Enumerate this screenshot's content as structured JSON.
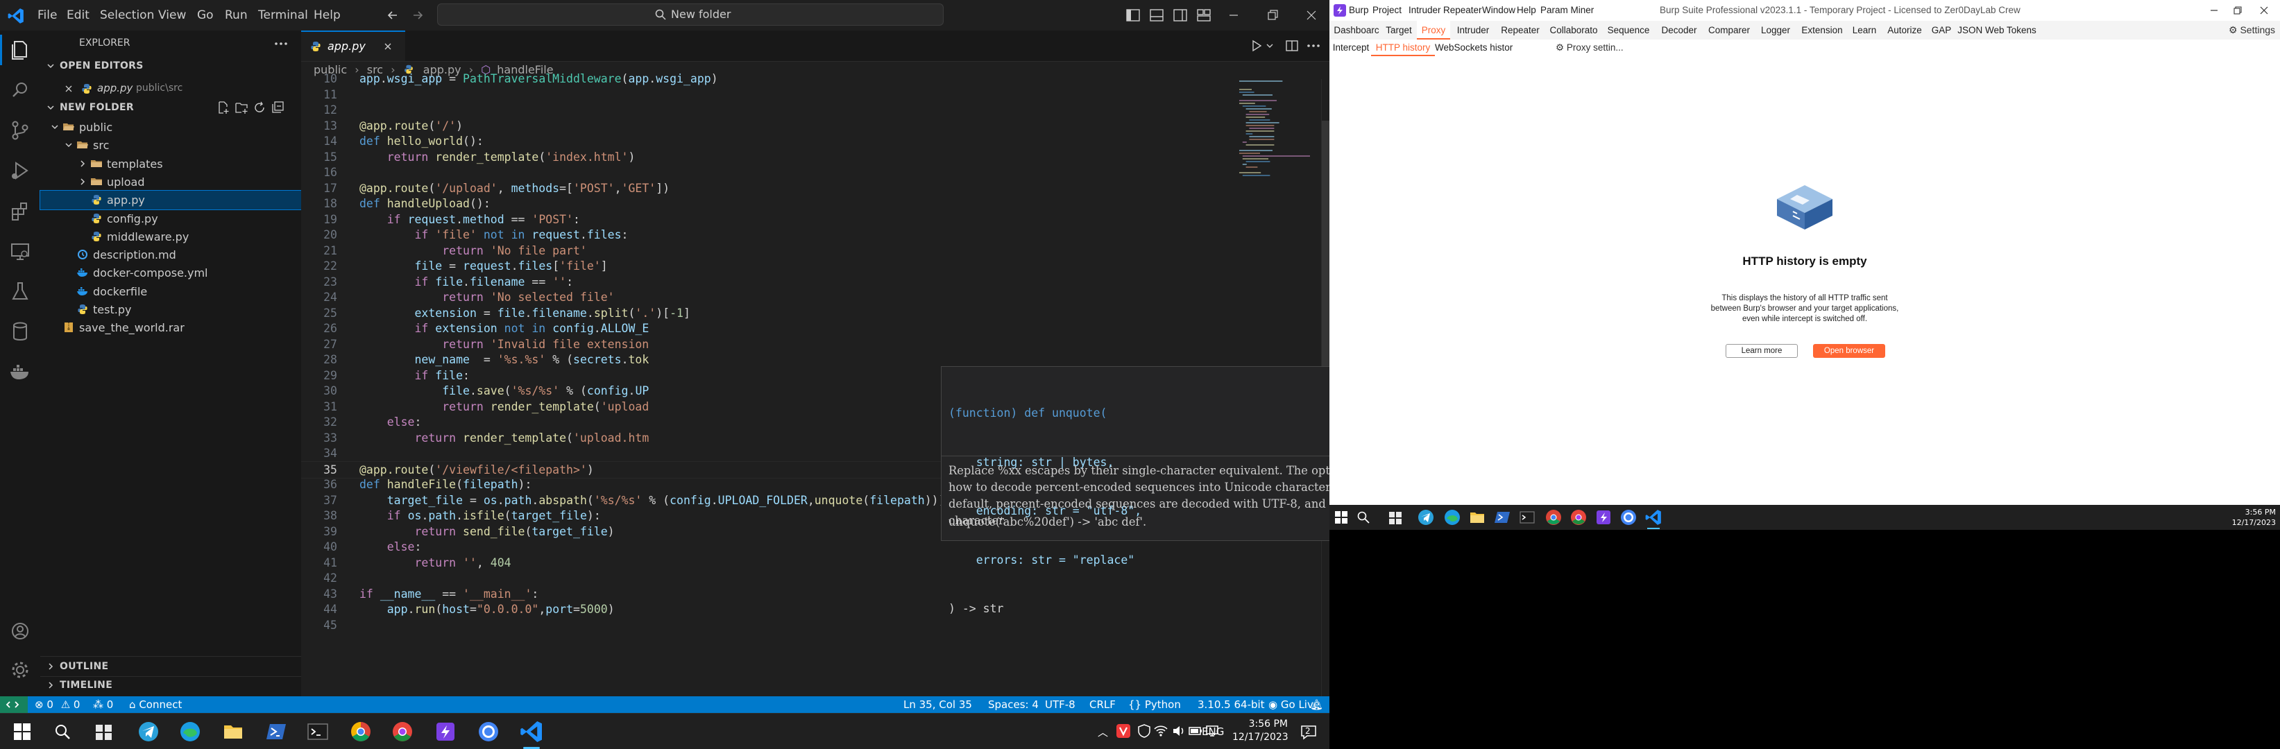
{
  "vscode": {
    "menu": [
      "File",
      "Edit",
      "Selection",
      "View",
      "Go",
      "Run",
      "Terminal",
      "Help"
    ],
    "command_center": "New folder",
    "explorer": {
      "title": "EXPLORER",
      "open_editors_header": "OPEN EDITORS",
      "open_editor_file": "app.py",
      "open_editor_path": "public\\src",
      "folder_header": "NEW FOLDER",
      "tree": [
        {
          "label": "public",
          "type": "folder-open",
          "depth": 0
        },
        {
          "label": "src",
          "type": "folder-open",
          "depth": 1
        },
        {
          "label": "templates",
          "type": "folder",
          "depth": 2
        },
        {
          "label": "upload",
          "type": "folder",
          "depth": 2
        },
        {
          "label": "app.py",
          "type": "python",
          "depth": 2,
          "selected": true
        },
        {
          "label": "config.py",
          "type": "python",
          "depth": 2
        },
        {
          "label": "middleware.py",
          "type": "python",
          "depth": 2
        },
        {
          "label": "description.md",
          "type": "markdown",
          "depth": 1
        },
        {
          "label": "docker-compose.yml",
          "type": "docker",
          "depth": 1
        },
        {
          "label": "dockerfile",
          "type": "docker",
          "depth": 1
        },
        {
          "label": "test.py",
          "type": "python",
          "depth": 1
        },
        {
          "label": "save_the_world.rar",
          "type": "archive",
          "depth": 0
        }
      ],
      "outline": "OUTLINE",
      "timeline": "TIMELINE"
    },
    "tab": {
      "label": "app.py"
    },
    "breadcrumb": [
      "public",
      "src",
      "app.py",
      "handleFile"
    ],
    "code_lines": [
      {
        "n": "10",
        "html": "<span class=\"v\">app</span>.<span class=\"v\">wsgi_app</span> = <span class=\"c4\">PathTraversalMiddleware</span>(<span class=\"v\">app</span>.<span class=\"v\">wsgi_app</span>)"
      },
      {
        "n": "11",
        "html": ""
      },
      {
        "n": "12",
        "html": ""
      },
      {
        "n": "13",
        "html": "<span class=\"d\">@app.route</span>(<span class=\"s\">'/'</span>)"
      },
      {
        "n": "14",
        "html": "<span class=\"kb\">def</span> <span class=\"f\">hello_world</span>():"
      },
      {
        "n": "15",
        "html": "    <span class=\"k\">return</span> <span class=\"f\">render_template</span>(<span class=\"s\">'index.html'</span>)"
      },
      {
        "n": "16",
        "html": ""
      },
      {
        "n": "17",
        "html": "<span class=\"d\">@app.route</span>(<span class=\"s\">'/upload'</span>, <span class=\"v\">methods</span>=[<span class=\"s\">'POST'</span>,<span class=\"s\">'GET'</span>])"
      },
      {
        "n": "18",
        "html": "<span class=\"kb\">def</span> <span class=\"f\">handleUpload</span>():"
      },
      {
        "n": "19",
        "html": "    <span class=\"k\">if</span> <span class=\"v\">request</span>.<span class=\"v\">method</span> == <span class=\"s\">'POST'</span>:"
      },
      {
        "n": "20",
        "html": "        <span class=\"k\">if</span> <span class=\"s\">'file'</span> <span class=\"kb\">not in</span> <span class=\"v\">request</span>.<span class=\"v\">files</span>:"
      },
      {
        "n": "21",
        "html": "            <span class=\"k\">return</span> <span class=\"s\">'No file part'</span>"
      },
      {
        "n": "22",
        "html": "        <span class=\"v\">file</span> = <span class=\"v\">request</span>.<span class=\"v\">files</span>[<span class=\"s\">'file'</span>]"
      },
      {
        "n": "23",
        "html": "        <span class=\"k\">if</span> <span class=\"v\">file</span>.<span class=\"v\">filename</span> == <span class=\"s\">''</span>:"
      },
      {
        "n": "24",
        "html": "            <span class=\"k\">return</span> <span class=\"s\">'No selected file'</span>"
      },
      {
        "n": "25",
        "html": "        <span class=\"v\">extension</span> = <span class=\"v\">file</span>.<span class=\"v\">filename</span>.<span class=\"f\">split</span>(<span class=\"s\">'.'</span>)[<span class=\"n\">-1</span>]"
      },
      {
        "n": "26",
        "html": "        <span class=\"k\">if</span> <span class=\"v\">extension</span> <span class=\"kb\">not in</span> <span class=\"v\">config</span>.<span class=\"v\">ALLOW_E</span>"
      },
      {
        "n": "27",
        "html": "            <span class=\"k\">return</span> <span class=\"s\">'Invalid file extension</span>"
      },
      {
        "n": "28",
        "html": "        <span class=\"v\">new_name</span>  = <span class=\"s\">'%s.%s'</span> % (<span class=\"v\">secrets</span>.<span class=\"f\">tok</span>"
      },
      {
        "n": "29",
        "html": "        <span class=\"k\">if</span> <span class=\"v\">file</span>:"
      },
      {
        "n": "30",
        "html": "            <span class=\"v\">file</span>.<span class=\"f\">save</span>(<span class=\"s\">'%s/%s'</span> % (<span class=\"v\">config</span>.<span class=\"v\">UP</span>"
      },
      {
        "n": "31",
        "html": "            <span class=\"k\">return</span> <span class=\"f\">render_template</span>(<span class=\"s\">'upload</span>"
      },
      {
        "n": "32",
        "html": "    <span class=\"k\">else</span>:"
      },
      {
        "n": "33",
        "html": "        <span class=\"k\">return</span> <span class=\"f\">render_template</span>(<span class=\"s\">'upload.htm</span>"
      },
      {
        "n": "34",
        "html": ""
      },
      {
        "n": "35",
        "html": "<span class=\"d\">@app.route</span>(<span class=\"s\">'/viewfile/&lt;filepath&gt;'</span>)",
        "current": true
      },
      {
        "n": "36",
        "html": "<span class=\"kb\">def</span> <span class=\"f\">handleFile</span>(<span class=\"v\">filepath</span>):"
      },
      {
        "n": "37",
        "html": "    <span class=\"v\">target_file</span> = <span class=\"v\">os</span>.<span class=\"v\">path</span>.<span class=\"f\">abspath</span>(<span class=\"s\">'%s/%s'</span> % (<span class=\"v\">config</span>.<span class=\"v\">UPLOAD_FOLDER</span>,<span class=\"f\">unquote</span>(<span class=\"v\">filepath</span>)))"
      },
      {
        "n": "38",
        "html": "    <span class=\"k\">if</span> <span class=\"v\">os</span>.<span class=\"v\">path</span>.<span class=\"f\">isfile</span>(<span class=\"v\">target_file</span>):"
      },
      {
        "n": "39",
        "html": "        <span class=\"k\">return</span> <span class=\"f\">send_file</span>(<span class=\"v\">target_file</span>)"
      },
      {
        "n": "40",
        "html": "    <span class=\"k\">else</span>:"
      },
      {
        "n": "41",
        "html": "        <span class=\"k\">return</span> <span class=\"s\">''</span>, <span class=\"n\">404</span>"
      },
      {
        "n": "42",
        "html": ""
      },
      {
        "n": "43",
        "html": "<span class=\"k\">if</span> <span class=\"v\">__name__</span> == <span class=\"s\">'__main__'</span>:"
      },
      {
        "n": "44",
        "html": "    <span class=\"v\">app</span>.<span class=\"f\">run</span>(<span class=\"v\">host</span>=<span class=\"s\">\"0.0.0.0\"</span>,<span class=\"v\">port</span>=<span class=\"n\">5000</span>)"
      },
      {
        "n": "45",
        "html": ""
      }
    ],
    "hover": {
      "signature": [
        "(function) def unquote(",
        "    string: str | bytes,",
        "    encoding: str = \"utf-8\",",
        "    errors: str = \"replace\"",
        ") -> str"
      ],
      "doc": "Replace %xx escapes by their single-character equivalent. The optional encoding and errors parameters specify how to decode percent-encoded sequences into Unicode characters, as accepted by the bytes.decode() method. By default, percent-encoded sequences are decoded with UTF-8, and invalid sequences are replaced by a placeholder character.",
      "example": "unquote('abc%20def') -> 'abc def'."
    },
    "status": {
      "errors": "0",
      "warnings": "0",
      "ports": "0",
      "connect": "Connect",
      "position": "Ln 35, Col 35",
      "spaces": "Spaces: 4",
      "encoding": "UTF-8",
      "eol": "CRLF",
      "language": "Python",
      "interpreter": "3.10.5 64-bit",
      "golive": "Go Live"
    },
    "taskbar": {
      "lang": "ENG",
      "time": "3:56 PM",
      "date": "12/17/2023",
      "notifications": "2"
    }
  },
  "burp": {
    "menu": [
      "Burp",
      "Project",
      "Intruder",
      "Repeater",
      "Window",
      "Help",
      "Param Miner"
    ],
    "title": "Burp Suite Professional v2023.1.1 - Temporary Project - Licensed to Zer0DayLab Crew",
    "tabs": [
      "Dashboarc",
      "Target",
      "Proxy",
      "Intruder",
      "Repeater",
      "Collaborato",
      "Sequence",
      "Decoder",
      "Comparer",
      "Logger",
      "Extension",
      "Learn",
      "Autorize",
      "GAP",
      "JSON Web Tokens"
    ],
    "active_tab": "Proxy",
    "settings": "Settings",
    "subtabs": [
      "Intercept",
      "HTTP history",
      "WebSockets histor"
    ],
    "active_subtab": "HTTP history",
    "proxy_settings": "Proxy settin...",
    "empty_title": "HTTP history is empty",
    "empty_desc": "This displays the history of all HTTP traffic sent between Burp's browser and your target applications, even while intercept is switched off.",
    "learn_more": "Learn more",
    "open_browser": "Open browser",
    "accent": "#ff6633",
    "taskbar_time": "3:56 PM",
    "taskbar_date": "12/17/2023"
  }
}
